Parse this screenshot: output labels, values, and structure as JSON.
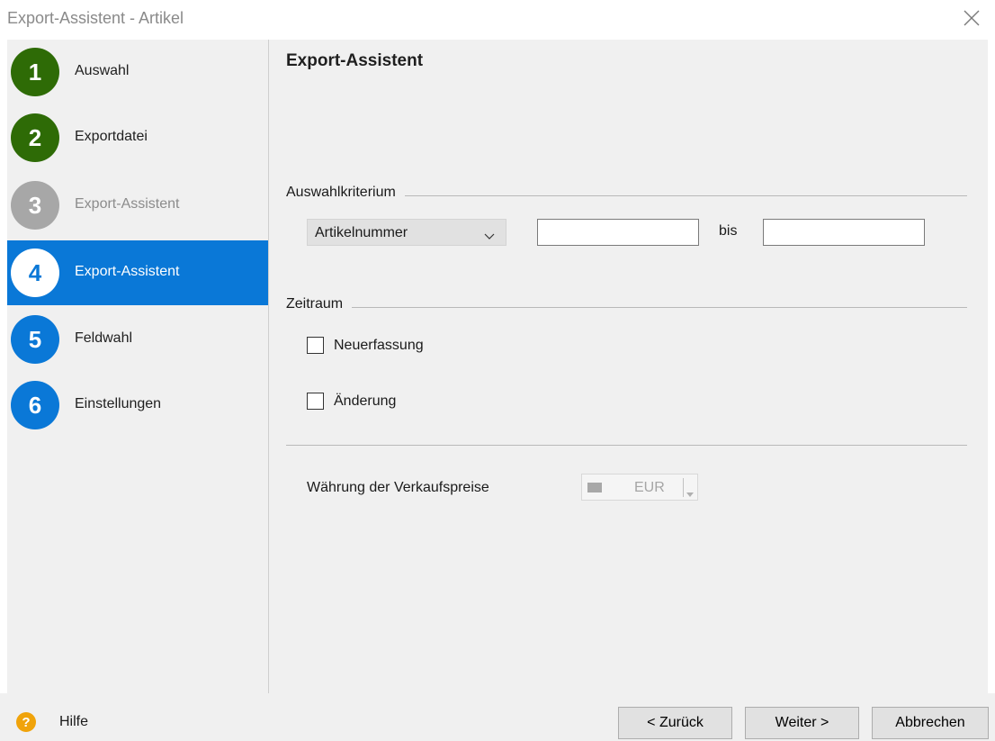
{
  "window": {
    "title": "Export-Assistent - Artikel"
  },
  "sidebar": {
    "steps": [
      {
        "number": "1",
        "label": "Auswahl",
        "state": "done"
      },
      {
        "number": "2",
        "label": "Exportdatei",
        "state": "done"
      },
      {
        "number": "3",
        "label": "Export-Assistent",
        "state": "disabled"
      },
      {
        "number": "4",
        "label": "Export-Assistent",
        "state": "active"
      },
      {
        "number": "5",
        "label": "Feldwahl",
        "state": "todo"
      },
      {
        "number": "6",
        "label": "Einstellungen",
        "state": "todo"
      }
    ]
  },
  "main": {
    "heading": "Export-Assistent",
    "auswahl": {
      "group_label": "Auswahlkriterium",
      "select_value": "Artikelnummer",
      "from_value": "",
      "bis_label": "bis",
      "to_value": ""
    },
    "zeitraum": {
      "group_label": "Zeitraum",
      "options": [
        {
          "label": "Neuerfassung",
          "checked": false
        },
        {
          "label": "Änderung",
          "checked": false
        }
      ]
    },
    "currency": {
      "label": "Währung der Verkaufspreise",
      "value": "EUR"
    }
  },
  "footer": {
    "help_label": "Hilfe",
    "back_label": "< Zurück",
    "next_label": "Weiter >",
    "cancel_label": "Abbrechen"
  },
  "colors": {
    "done": "#2e6b06",
    "active": "#0a78d7",
    "disabled": "#a7a7a7",
    "help": "#f0a30a"
  },
  "icons": [
    "close-icon",
    "chevron-down-icon",
    "help-icon",
    "flag-icon"
  ]
}
